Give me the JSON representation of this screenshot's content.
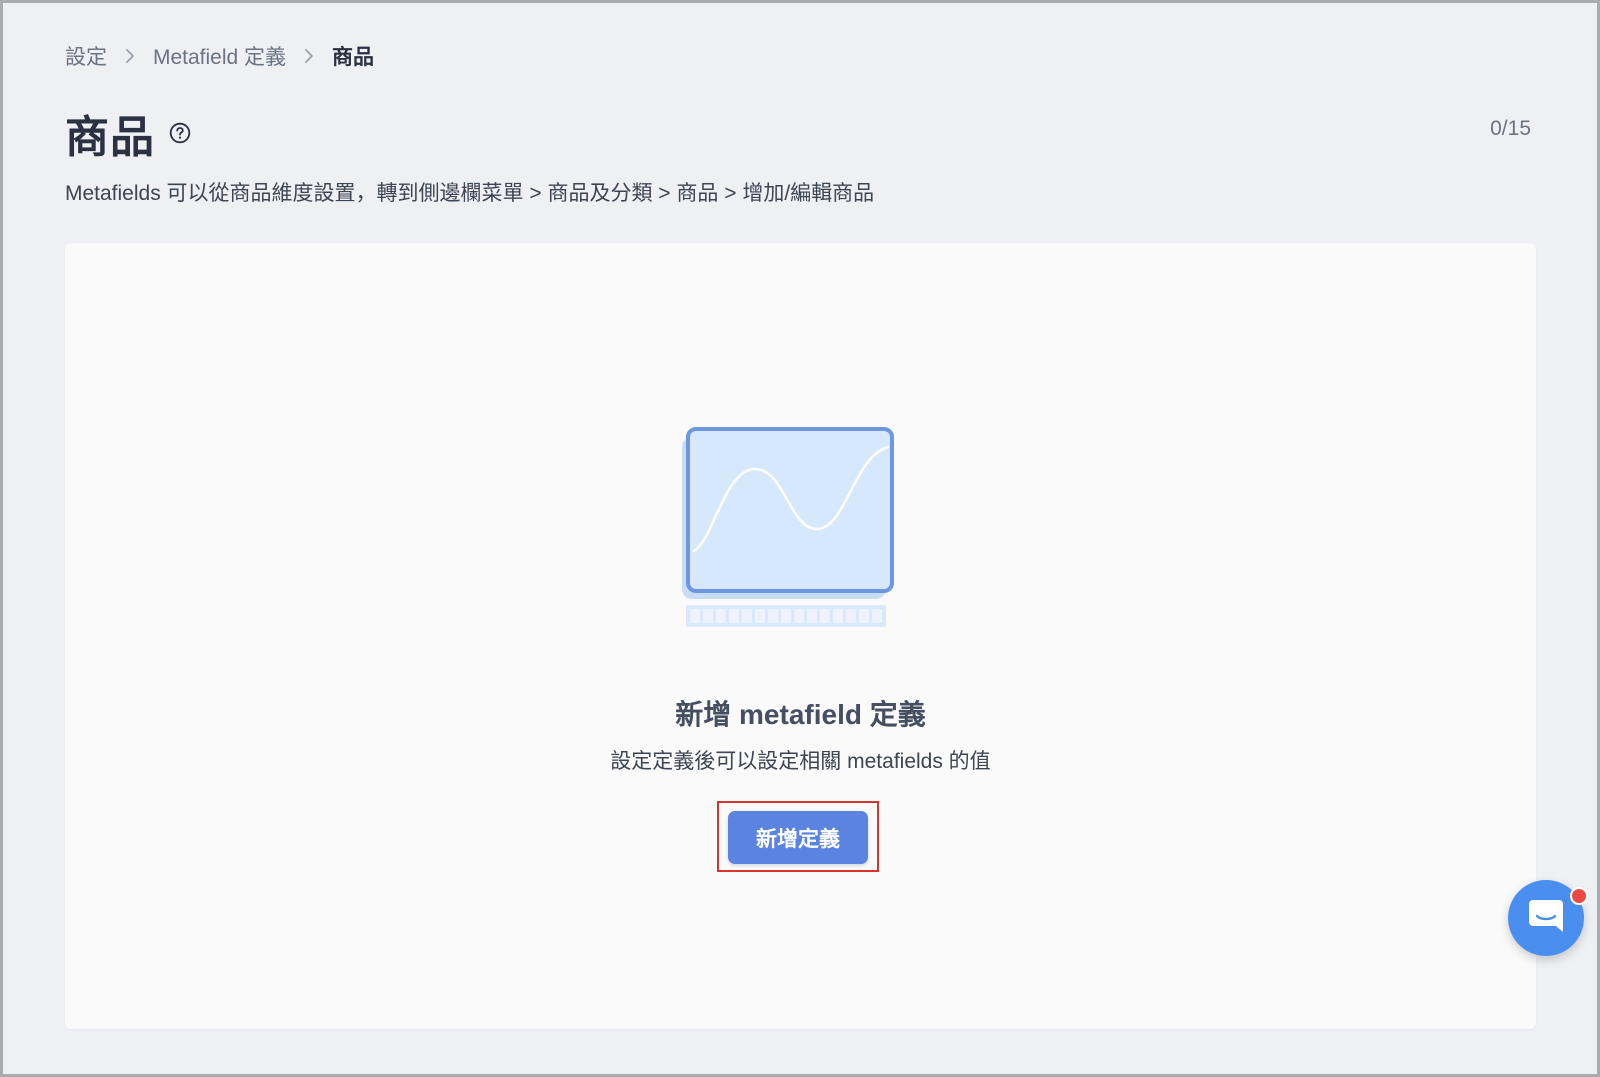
{
  "breadcrumb": {
    "items": [
      {
        "label": "設定"
      },
      {
        "label": "Metafield 定義"
      },
      {
        "label": "商品"
      }
    ]
  },
  "header": {
    "title": "商品",
    "counter": "0/15",
    "description": "Metafields 可以從商品維度設置，轉到側邊欄菜單 > 商品及分類 > 商品 > 增加/編輯商品"
  },
  "empty_state": {
    "title": "新增 metafield 定義",
    "subtitle": "設定定義後可以設定相關 metafields 的值",
    "button_label": "新增定義"
  },
  "icons": {
    "help": "question-circle-icon",
    "breadcrumb_separator": "chevron-right-icon",
    "illustration": "empty-chart-monitor-illustration",
    "chat": "chat-bubble-icon"
  },
  "colors": {
    "primary": "#5b84e0",
    "chat_launcher": "#4a8ff0",
    "notification": "#ea4a44",
    "highlight": "#d9342b"
  }
}
